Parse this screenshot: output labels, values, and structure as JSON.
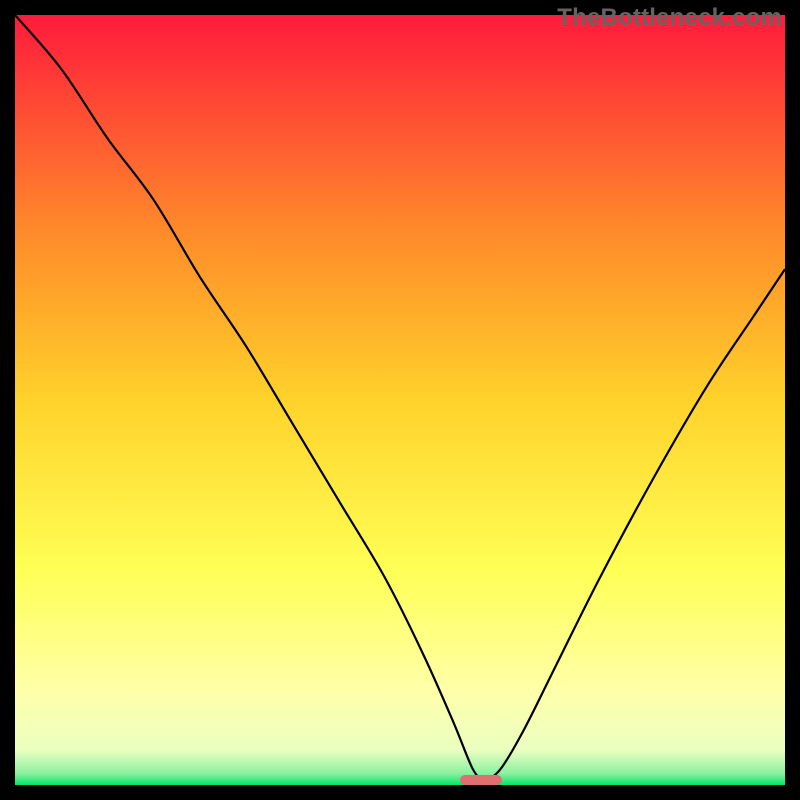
{
  "watermark": {
    "text": "TheBottleneck.com"
  },
  "colors": {
    "gradient_top": "#ff1a3c",
    "gradient_upper_mid": "#ff8a2a",
    "gradient_mid": "#ffd22a",
    "gradient_lower_mid": "#ffff55",
    "gradient_pale": "#ffffaa",
    "gradient_bottom": "#00e86a",
    "curve": "#000000",
    "marker": "#e07070",
    "frame": "#000000"
  },
  "chart_data": {
    "type": "line",
    "title": "",
    "xlabel": "",
    "ylabel": "",
    "xlim": [
      0,
      100
    ],
    "ylim": [
      0,
      100
    ],
    "note": "No axis ticks or numeric labels are rendered on the chart; values below are read from relative position within the 770×770 plot area (0–100 scale).",
    "series": [
      {
        "name": "bottleneck-curve",
        "x": [
          0,
          6,
          12,
          18,
          24,
          30,
          36,
          42,
          48,
          53,
          57,
          59.5,
          61,
          63,
          66,
          70,
          76,
          83,
          90,
          96,
          100
        ],
        "y": [
          100,
          93,
          84,
          76,
          66,
          57,
          47,
          37,
          27,
          17,
          8,
          2,
          0.8,
          2,
          7,
          15,
          27,
          40,
          52,
          61,
          67
        ]
      }
    ],
    "marker": {
      "x_center": 60.5,
      "y": 0.6,
      "width_pct": 5.5
    },
    "background_gradient_stops": [
      {
        "offset": 0.0,
        "color": "#ff1a3c"
      },
      {
        "offset": 0.28,
        "color": "#ff8a2a"
      },
      {
        "offset": 0.5,
        "color": "#ffd22a"
      },
      {
        "offset": 0.72,
        "color": "#ffff55"
      },
      {
        "offset": 0.88,
        "color": "#ffffaa"
      },
      {
        "offset": 0.955,
        "color": "#eaffc0"
      },
      {
        "offset": 0.985,
        "color": "#8cf0a0"
      },
      {
        "offset": 1.0,
        "color": "#00e86a"
      }
    ]
  }
}
